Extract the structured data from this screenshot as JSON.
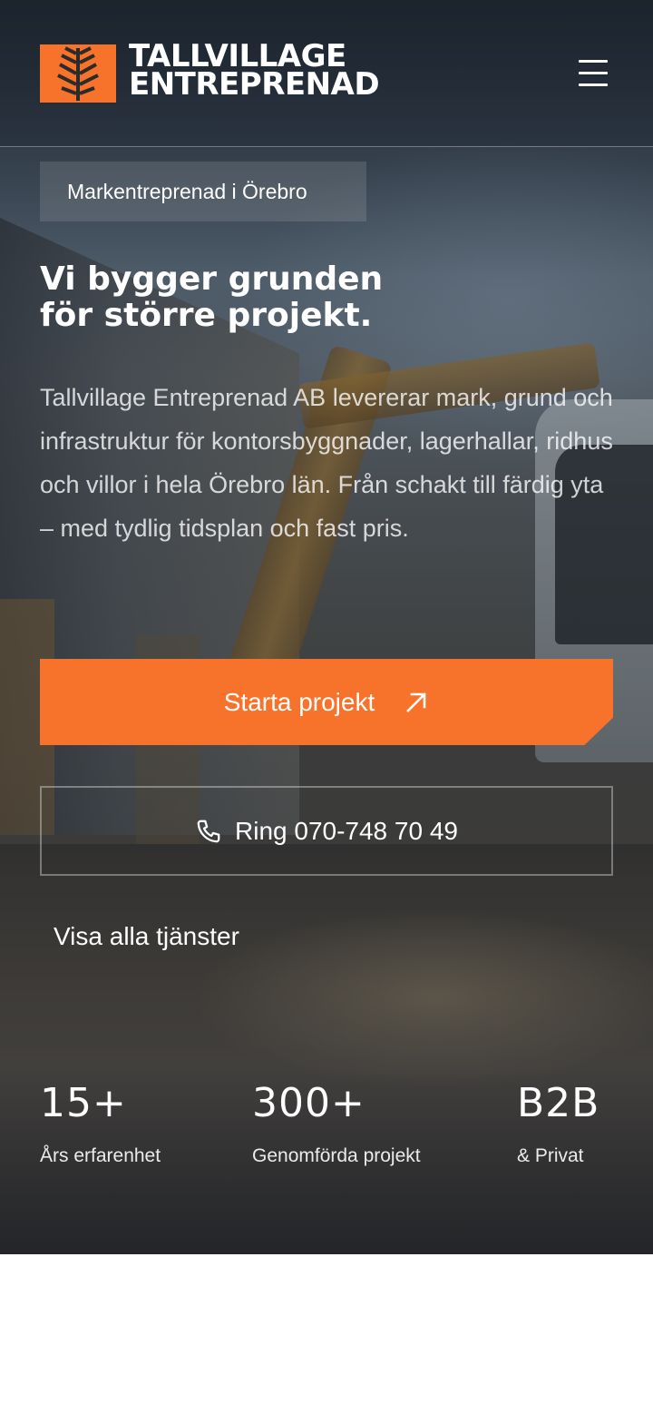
{
  "header": {
    "brand_line_1": "TALLVILLAGE",
    "brand_line_2": "ENTREPRENAD",
    "logo_icon": "pine-tree-icon",
    "menu_icon": "hamburger-menu-icon"
  },
  "hero": {
    "badge": "Markentreprenad i Örebro",
    "headline_line_1": "Vi bygger grunden",
    "headline_line_2": "för större projekt.",
    "lead": "Tallvillage Entreprenad AB levererar mark, grund och infrastruktur för kontorsbyggnader, lagerhallar, ridhus och villor i hela Örebro län. Från schakt till färdig yta – med tydlig tidsplan och fast pris.",
    "primary_cta": "Starta projekt",
    "primary_cta_icon": "arrow-up-right-icon",
    "phone_cta": "Ring 070-748 70 49",
    "phone_icon": "phone-icon",
    "services_link": "Visa alla tjänster"
  },
  "stats": [
    {
      "value": "15+",
      "label": "Års erfarenhet"
    },
    {
      "value": "300+",
      "label": "Genomförda projekt"
    },
    {
      "value": "B2B",
      "label": "& Privat"
    }
  ],
  "colors": {
    "accent": "#f7722a",
    "text": "#ffffff",
    "page_background": "#ffffff"
  }
}
